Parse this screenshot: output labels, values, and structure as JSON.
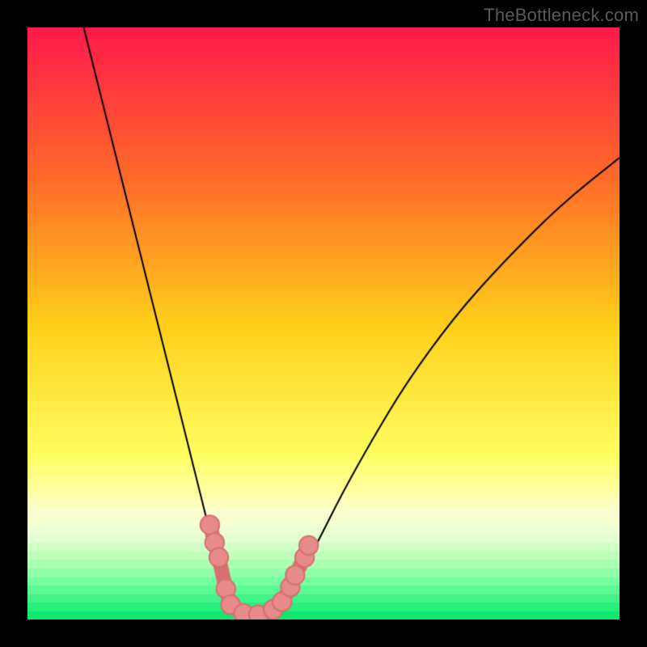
{
  "watermark": "TheBottleneck.com",
  "chart_data": {
    "type": "line",
    "title": "",
    "xlabel": "",
    "ylabel": "",
    "xlim": [
      0,
      100
    ],
    "ylim": [
      0,
      100
    ],
    "grid": false,
    "legend": false,
    "background": {
      "type": "vertical-gradient-banded",
      "stops": [
        {
          "y": 0,
          "color": "#ff1a4b"
        },
        {
          "y": 25,
          "color": "#ff6a2a"
        },
        {
          "y": 50,
          "color": "#ffcf1a"
        },
        {
          "y": 72,
          "color": "#ffff60"
        },
        {
          "y": 78,
          "color": "#ffffa0"
        },
        {
          "y": 82,
          "color": "#fcffd0"
        },
        {
          "y": 86,
          "color": "#e6ffd6"
        },
        {
          "y": 90,
          "color": "#b6ffb6"
        },
        {
          "y": 94,
          "color": "#6dff9f"
        },
        {
          "y": 100,
          "color": "#00e56a"
        }
      ]
    },
    "series": [
      {
        "name": "left-curve",
        "color": "#000000",
        "width": 2,
        "points": [
          {
            "x": 9.5,
            "y": 0
          },
          {
            "x": 12.0,
            "y": 10
          },
          {
            "x": 14.5,
            "y": 20
          },
          {
            "x": 17.0,
            "y": 30
          },
          {
            "x": 19.5,
            "y": 40
          },
          {
            "x": 22.0,
            "y": 50
          },
          {
            "x": 24.5,
            "y": 60
          },
          {
            "x": 27.0,
            "y": 70
          },
          {
            "x": 29.0,
            "y": 78
          },
          {
            "x": 30.5,
            "y": 84
          },
          {
            "x": 32.0,
            "y": 90
          },
          {
            "x": 33.5,
            "y": 95
          },
          {
            "x": 35.5,
            "y": 98.5
          },
          {
            "x": 38.0,
            "y": 99.3
          }
        ]
      },
      {
        "name": "right-curve",
        "color": "#000000",
        "width": 2,
        "points": [
          {
            "x": 38.0,
            "y": 99.3
          },
          {
            "x": 41.0,
            "y": 98.7
          },
          {
            "x": 43.5,
            "y": 96.5
          },
          {
            "x": 46.0,
            "y": 92.5
          },
          {
            "x": 49.0,
            "y": 87
          },
          {
            "x": 53.0,
            "y": 79
          },
          {
            "x": 58.0,
            "y": 70
          },
          {
            "x": 64.0,
            "y": 60
          },
          {
            "x": 72.0,
            "y": 49
          },
          {
            "x": 80.0,
            "y": 40
          },
          {
            "x": 90.0,
            "y": 30
          },
          {
            "x": 100.0,
            "y": 22
          }
        ]
      }
    ],
    "highlight_band": {
      "name": "bottleneck-marker",
      "color": "#e68a8a",
      "stroke": "#d87070",
      "radius": 1.6,
      "line_width": 6,
      "points": [
        {
          "x": 30.8,
          "y": 84.0
        },
        {
          "x": 31.6,
          "y": 87.0
        },
        {
          "x": 32.3,
          "y": 89.5
        },
        {
          "x": 33.5,
          "y": 94.8
        },
        {
          "x": 34.3,
          "y": 97.5
        },
        {
          "x": 36.5,
          "y": 99.0
        },
        {
          "x": 39.0,
          "y": 99.2
        },
        {
          "x": 41.5,
          "y": 98.3
        },
        {
          "x": 43.0,
          "y": 97.0
        },
        {
          "x": 44.4,
          "y": 94.5
        },
        {
          "x": 45.2,
          "y": 92.5
        },
        {
          "x": 46.8,
          "y": 89.5
        },
        {
          "x": 47.5,
          "y": 87.5
        }
      ]
    }
  }
}
